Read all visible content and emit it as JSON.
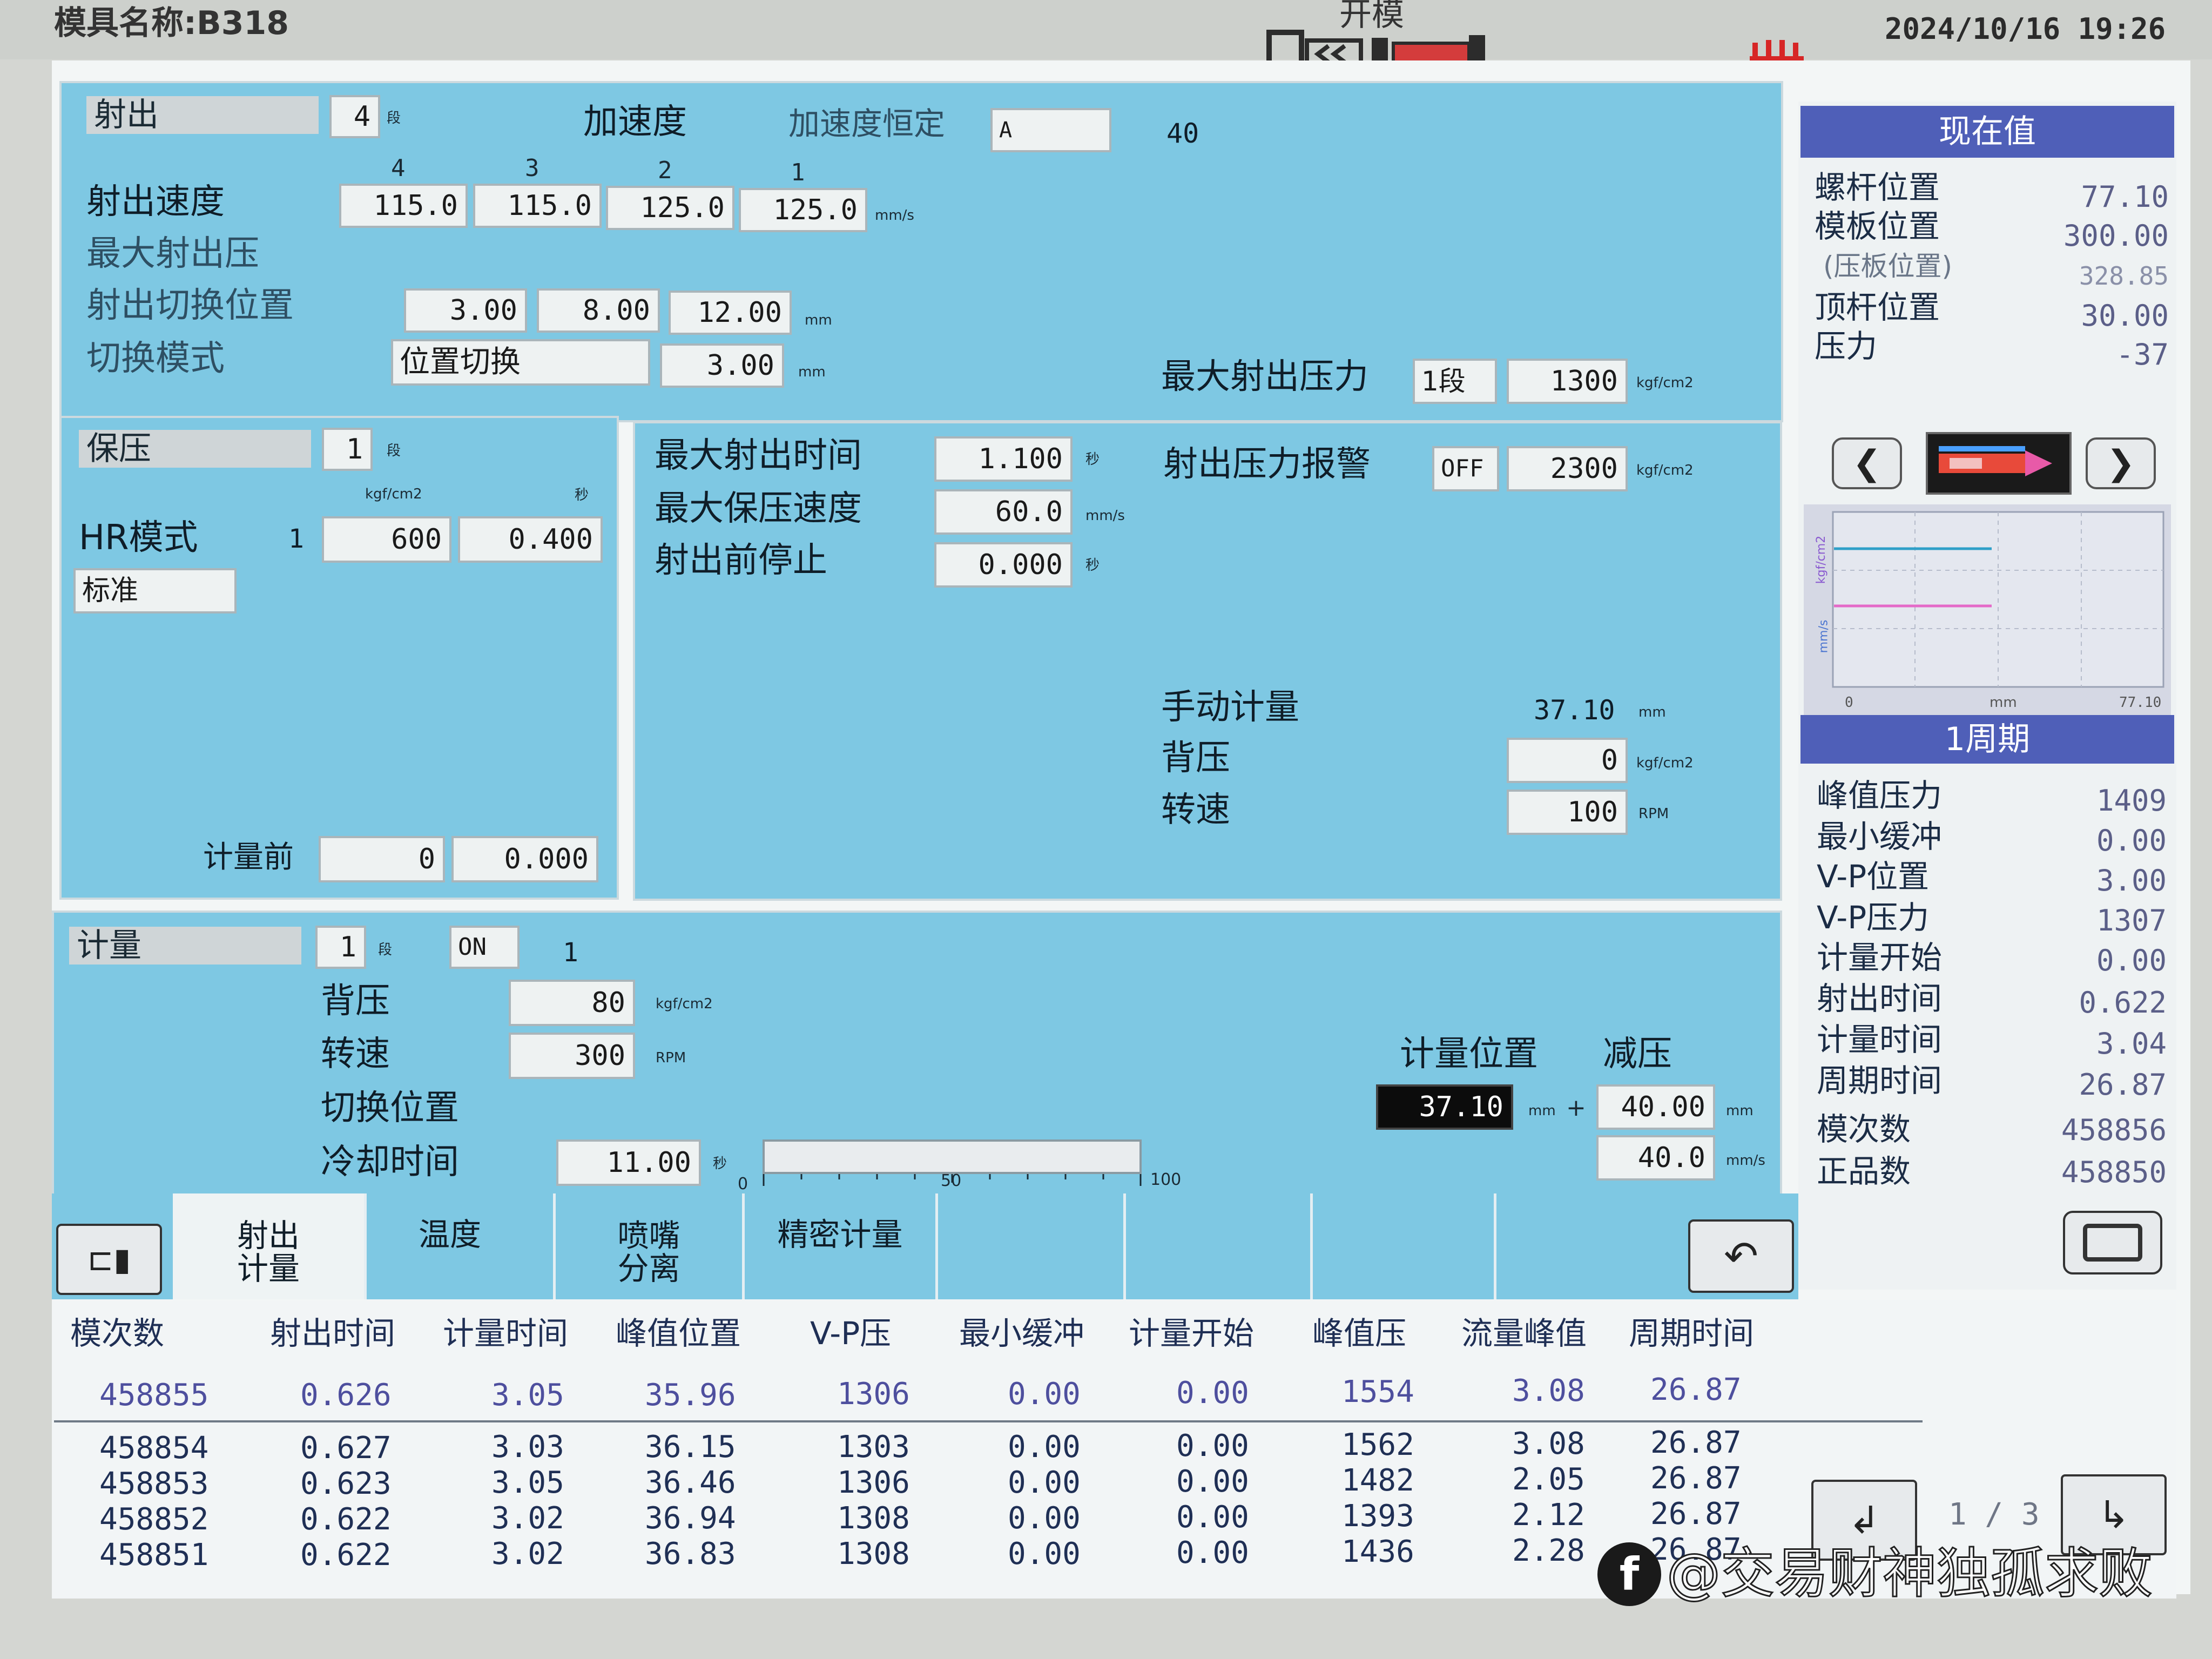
{
  "topbar": {
    "mold_name": "模具名称:B318",
    "mode": "开模",
    "datetime": "2024/10/16 19:26"
  },
  "injection": {
    "title": "射出",
    "stages": "4",
    "stage_unit": "段",
    "accel_label": "加速度",
    "accel_const_label": "加速度恒定",
    "accel_const_value": "A",
    "accel_value": "40",
    "stage_numbers": [
      "4",
      "3",
      "2",
      "1"
    ],
    "speed_label": "射出速度",
    "speeds": [
      "115.0",
      "115.0",
      "125.0",
      "125.0"
    ],
    "speed_unit": "mm/s",
    "max_pressure_label": "最大射出压",
    "switch_pos_label": "射出切换位置",
    "switch_positions": [
      "3.00",
      "8.00",
      "12.00"
    ],
    "pos_unit": "mm",
    "switch_mode_label": "切换模式",
    "switch_mode_value": "位置切换",
    "switch_mode_pos": "3.00",
    "max_inj_pressure_label": "最大射出压力",
    "max_inj_pressure_stage": "1段",
    "max_inj_pressure_value": "1300",
    "pressure_unit": "kgf/cm2"
  },
  "holding": {
    "title": "保压",
    "stages": "1",
    "stage_unit": "段",
    "col_unit_pressure": "kgf/cm2",
    "col_unit_time": "秒",
    "hr_label": "HR模式",
    "row_index": "1",
    "pressure": "600",
    "time": "0.400",
    "mode_value": "标准",
    "pre_meter_label": "计量前",
    "pre_meter_pressure": "0",
    "pre_meter_time": "0.000"
  },
  "mid": {
    "max_inj_time_label": "最大射出时间",
    "max_inj_time": "1.100",
    "time_unit": "秒",
    "max_hold_speed_label": "最大保压速度",
    "max_hold_speed": "60.0",
    "speed_unit": "mm/s",
    "pre_stop_label": "射出前停止",
    "pre_stop": "0.000",
    "alarm_label": "射出压力报警",
    "alarm_state": "OFF",
    "alarm_value": "2300",
    "pressure_unit": "kgf/cm2",
    "manual_meter_label": "手动计量",
    "manual_meter_value": "37.10",
    "mm_unit": "mm",
    "back_pressure_label": "背压",
    "back_pressure": "0",
    "rpm_label": "转速",
    "rpm": "100",
    "rpm_unit": "RPM"
  },
  "metering": {
    "title": "计量",
    "stages": "1",
    "stage_unit": "段",
    "on_state": "ON",
    "on_index": "1",
    "back_pressure_label": "背压",
    "back_pressure": "80",
    "pressure_unit": "kgf/cm2",
    "rpm_label": "转速",
    "rpm": "300",
    "rpm_unit": "RPM",
    "switch_pos_label": "切换位置",
    "cooling_label": "冷却时间",
    "cooling_time": "11.00",
    "time_unit": "秒",
    "scale_labels": [
      "0",
      "50",
      "100"
    ],
    "meter_pos_label": "计量位置",
    "decomp_label": "减压",
    "meter_pos_value": "37.10",
    "meter_pos_unit": "mm",
    "plus": "+",
    "decomp_pos": "40.00",
    "decomp_pos_unit": "mm",
    "decomp_speed": "40.0",
    "decomp_speed_unit": "mm/s"
  },
  "sidebar": {
    "current_title": "现在值",
    "current": [
      {
        "label": "螺杆位置",
        "value": "77.10"
      },
      {
        "label": "模板位置",
        "value": "300.00"
      },
      {
        "label": "(压板位置)",
        "value": "328.85"
      },
      {
        "label": "顶杆位置",
        "value": "30.00"
      },
      {
        "label": "压力",
        "value": "-37"
      }
    ],
    "graph": {
      "y_top_label": "kgf/cm2",
      "y_bottom_label": "mm/s",
      "x_start": "0",
      "x_unit": "mm",
      "x_end": "77.10"
    },
    "cycle_title": "1周期",
    "cycle": [
      {
        "label": "峰值压力",
        "value": "1409"
      },
      {
        "label": "最小缓冲",
        "value": "0.00"
      },
      {
        "label": "V-P位置",
        "value": "3.00"
      },
      {
        "label": "V-P压力",
        "value": "1307"
      },
      {
        "label": "计量开始",
        "value": "0.00"
      },
      {
        "label": "射出时间",
        "value": "0.622"
      },
      {
        "label": "计量时间",
        "value": "3.04"
      },
      {
        "label": "周期时间",
        "value": "26.87"
      },
      {
        "label": "模次数",
        "value": "458856"
      },
      {
        "label": "正品数",
        "value": "458850"
      }
    ]
  },
  "tabs": [
    {
      "label": "射出\n计量"
    },
    {
      "label": "温度"
    },
    {
      "label": "喷嘴\n分离"
    },
    {
      "label": "精密计量"
    }
  ],
  "table": {
    "headers": [
      "模次数",
      "射出时间",
      "计量时间",
      "峰值位置",
      "V-P压",
      "最小缓冲",
      "计量开始",
      "峰值压",
      "流量峰值",
      "周期时间"
    ],
    "rows": [
      [
        "458855",
        "0.626",
        "3.05",
        "35.96",
        "1306",
        "0.00",
        "0.00",
        "1554",
        "3.08",
        "26.87"
      ],
      [
        "458854",
        "0.627",
        "3.03",
        "36.15",
        "1303",
        "0.00",
        "0.00",
        "1562",
        "3.08",
        "26.87"
      ],
      [
        "458853",
        "0.623",
        "3.05",
        "36.46",
        "1306",
        "0.00",
        "0.00",
        "1482",
        "2.05",
        "26.87"
      ],
      [
        "458852",
        "0.622",
        "3.02",
        "36.94",
        "1308",
        "0.00",
        "0.00",
        "1393",
        "2.12",
        "26.87"
      ],
      [
        "458851",
        "0.622",
        "3.02",
        "36.83",
        "1308",
        "0.00",
        "0.00",
        "1436",
        "2.28",
        "26.87"
      ]
    ],
    "page": "1 / 3"
  },
  "watermark": "@交易财神独孤求败",
  "colors": {
    "panel": "#7ec8e3",
    "sidebar_header": "#4f5fb8",
    "value_text": "#5b5f88"
  }
}
